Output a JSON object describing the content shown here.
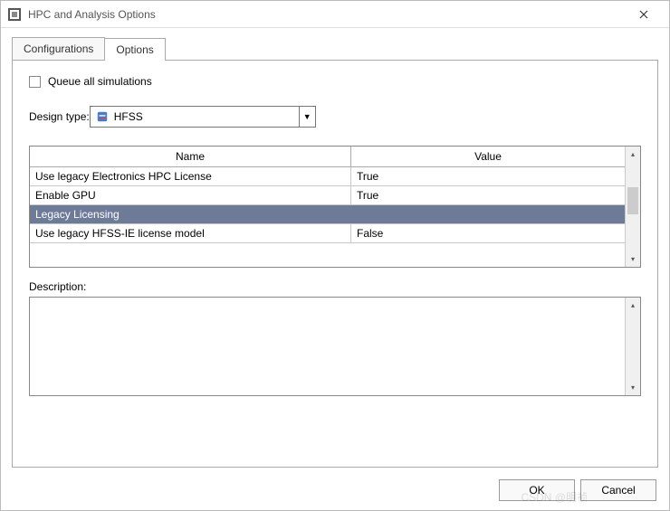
{
  "window": {
    "title": "HPC and Analysis Options"
  },
  "tabs": [
    {
      "label": "Configurations",
      "active": false
    },
    {
      "label": "Options",
      "active": true
    }
  ],
  "options": {
    "queue_checkbox_label": "Queue all simulations",
    "queue_checked": false,
    "design_type_label": "Design type:",
    "design_type_value": "HFSS"
  },
  "table": {
    "headers": {
      "name": "Name",
      "value": "Value"
    },
    "rows": [
      {
        "name": "Use legacy Electronics HPC License",
        "value": "True",
        "selected": false
      },
      {
        "name": "Enable GPU",
        "value": "True",
        "selected": false
      },
      {
        "name": "Legacy Licensing",
        "value": "",
        "selected": true
      },
      {
        "name": "Use legacy HFSS-IE license model",
        "value": "False",
        "selected": false
      }
    ]
  },
  "description": {
    "label": "Description:",
    "text": ""
  },
  "buttons": {
    "ok": "OK",
    "cancel": "Cancel"
  },
  "watermark": "CSDN @明祯"
}
